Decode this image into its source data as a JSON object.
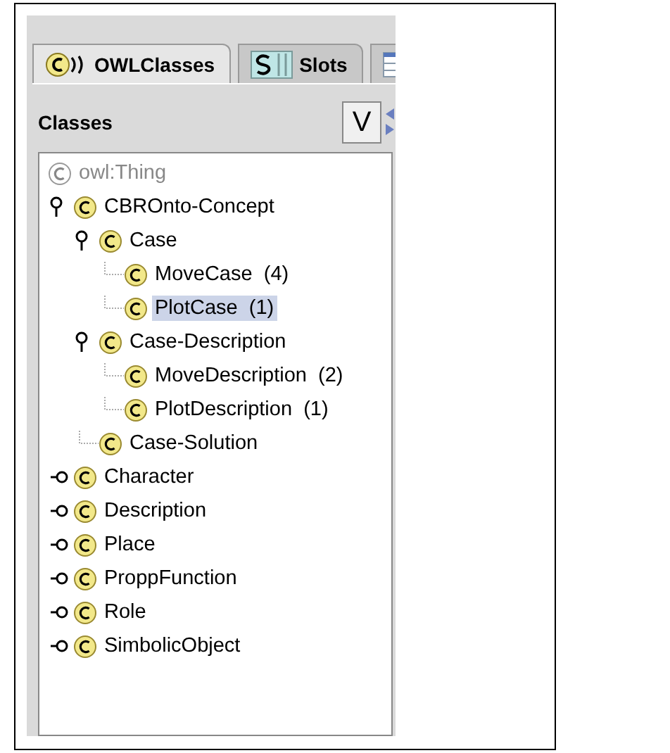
{
  "tabs": [
    {
      "label": "OWLClasses",
      "kind": "classes",
      "selected": true
    },
    {
      "label": "Slots",
      "kind": "slots",
      "selected": false
    },
    {
      "kind": "forms",
      "selected": false
    }
  ],
  "header": {
    "title": "Classes",
    "button": "V"
  },
  "tree": [
    {
      "label": "owl:Thing",
      "kind": "root",
      "selected": false,
      "children": [
        {
          "label": "CBROnto-Concept",
          "kind": "class",
          "selected": false,
          "expanded": true,
          "children": [
            {
              "label": "Case",
              "kind": "class",
              "selected": false,
              "expanded": true,
              "children": [
                {
                  "label": "MoveCase  (4)",
                  "kind": "class",
                  "selected": false
                },
                {
                  "label": "PlotCase  (1)",
                  "kind": "class",
                  "selected": true
                }
              ]
            },
            {
              "label": "Case-Description",
              "kind": "class",
              "selected": false,
              "expanded": true,
              "children": [
                {
                  "label": "MoveDescription  (2)",
                  "kind": "class",
                  "selected": false
                },
                {
                  "label": "PlotDescription  (1)",
                  "kind": "class",
                  "selected": false
                }
              ]
            },
            {
              "label": "Case-Solution",
              "kind": "class",
              "selected": false
            }
          ]
        },
        {
          "label": "Character",
          "kind": "class",
          "selected": false,
          "expanded": false
        },
        {
          "label": "Description",
          "kind": "class",
          "selected": false,
          "expanded": false
        },
        {
          "label": "Place",
          "kind": "class",
          "selected": false,
          "expanded": false
        },
        {
          "label": "ProppFunction",
          "kind": "class",
          "selected": false,
          "expanded": false
        },
        {
          "label": "Role",
          "kind": "class",
          "selected": false,
          "expanded": false
        },
        {
          "label": "SimbolicObject",
          "kind": "class",
          "selected": false,
          "expanded": false
        }
      ]
    }
  ]
}
